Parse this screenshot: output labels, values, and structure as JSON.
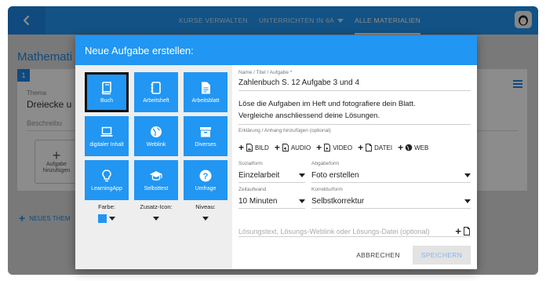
{
  "topbar": {
    "tabs": [
      {
        "label": "KURSE VERWALTEN"
      },
      {
        "label": "UNTERRICHTEN IN 6A"
      },
      {
        "label": "ALLE MATERIALIEN"
      }
    ],
    "back_icon": "chevron-left-icon",
    "avatar_icon": "penguin-avatar"
  },
  "background": {
    "page_title": "Mathemati",
    "card_number": "1",
    "theme_label": "Thema",
    "theme_value": "Dreiecke u",
    "description_label": "Beschreibu",
    "add_task_label": "Aufgabe hinzufügen",
    "new_theme_label": "NEUES THEM"
  },
  "modal": {
    "title": "Neue Aufgabe erstellen:",
    "types": [
      {
        "label": "Buch",
        "icon": "book-icon",
        "selected": true
      },
      {
        "label": "Arbeitsheft",
        "icon": "workbook-icon",
        "selected": false
      },
      {
        "label": "Arbeitsblatt",
        "icon": "worksheet-icon",
        "selected": false
      },
      {
        "label": "digitaler Inhalt",
        "icon": "laptop-icon",
        "selected": false
      },
      {
        "label": "Weblink",
        "icon": "globe-icon",
        "selected": false
      },
      {
        "label": "Diverses",
        "icon": "archive-icon",
        "selected": false
      },
      {
        "label": "LearningApp",
        "icon": "lightbulb-icon",
        "selected": false
      },
      {
        "label": "Selbsttest",
        "icon": "graduation-cap-icon",
        "selected": false
      },
      {
        "label": "Umfrage",
        "icon": "question-icon",
        "selected": false
      }
    ],
    "options": {
      "color_label": "Farbe:",
      "icon_label": "Zusatz-Icon:",
      "level_label": "Niveau:",
      "color_value": "#2196f3"
    },
    "form": {
      "name_label": "Name / Titel / Aufgabe *",
      "name_value": "Zahlenbuch S. 12 Aufgabe 3 und 4",
      "description_line1": "Löse die Aufgaben im Heft und fotografiere dein Blatt.",
      "description_line2": "Vergleiche anschliessend deine Lösungen.",
      "attachment_label": "Erklärung / Anhang hinzufügen (optional)",
      "attachments": [
        {
          "label": "BILD",
          "icon": "image-file-icon"
        },
        {
          "label": "AUDIO",
          "icon": "audio-file-icon"
        },
        {
          "label": "VIDEO",
          "icon": "video-file-icon"
        },
        {
          "label": "DATEI",
          "icon": "file-icon"
        },
        {
          "label": "WEB",
          "icon": "globe-icon"
        }
      ],
      "social_label": "Sozialform",
      "social_value": "Einzelarbeit",
      "delivery_label": "Abgabeform",
      "delivery_value": "Foto erstellen",
      "time_label": "Zeitaufwand",
      "time_value": "10 Minuten",
      "correction_label": "Korrekturform",
      "correction_value": "Selbstkorrektur",
      "solution_placeholder": "Lösungstext, Lösungs-Weblink oder Lösungs-Datei (optional)"
    },
    "buttons": {
      "cancel": "ABBRECHEN",
      "save": "SPEICHERN"
    }
  },
  "colors": {
    "primary": "#2196f3",
    "overlay": "rgba(0,0,0,0.45)"
  }
}
